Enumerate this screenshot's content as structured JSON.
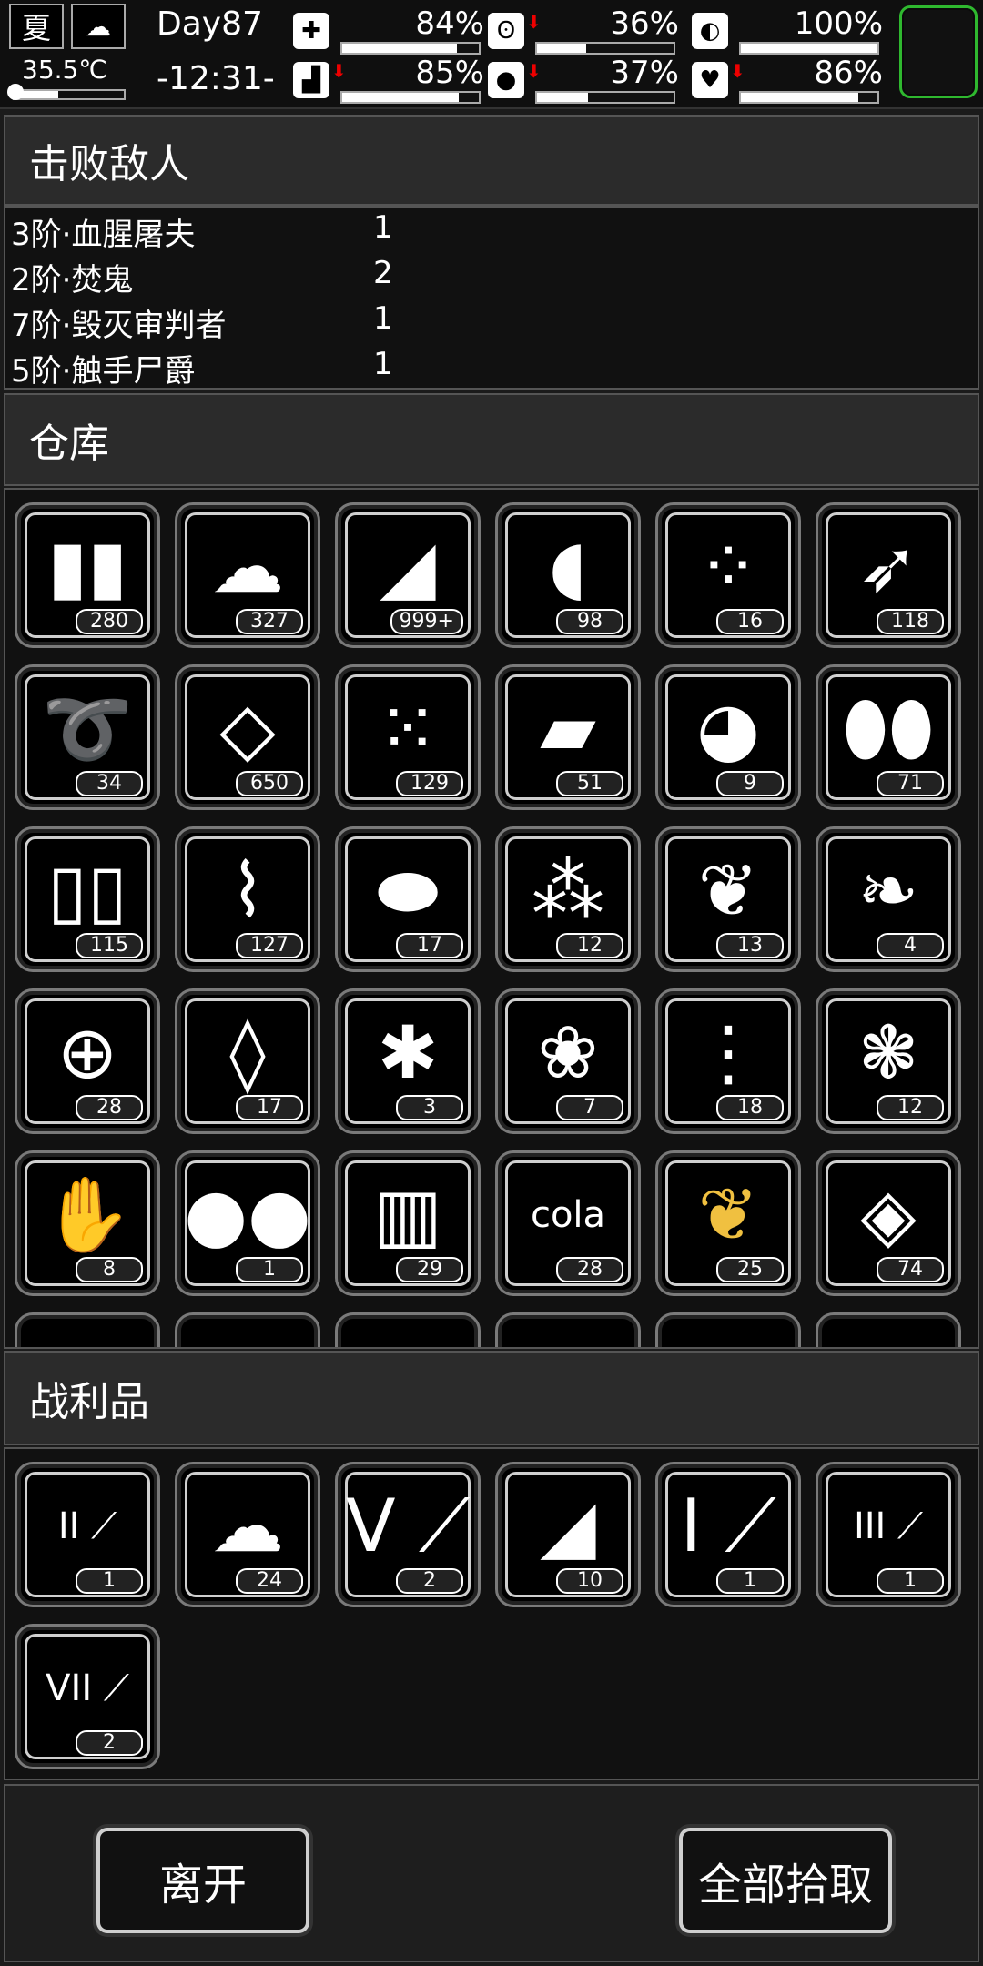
{
  "status": {
    "season": "夏",
    "weather_icon": "cloud-icon",
    "temperature": "35.5℃",
    "day": "Day87",
    "time": "-12:31-",
    "stats": [
      {
        "icon": "health-icon",
        "glyph": "✚",
        "percent": "84%",
        "value": 0.84,
        "arrow": false
      },
      {
        "icon": "stomach-icon",
        "glyph": "ʘ",
        "percent": "36%",
        "value": 0.36,
        "arrow": true
      },
      {
        "icon": "pill-icon",
        "glyph": "◐",
        "percent": "100%",
        "value": 1.0,
        "arrow": false
      },
      {
        "icon": "leg-icon",
        "glyph": "▟",
        "percent": "85%",
        "value": 0.85,
        "arrow": true
      },
      {
        "icon": "water-drop-icon",
        "glyph": "●",
        "percent": "37%",
        "value": 0.37,
        "arrow": true
      },
      {
        "icon": "heart-icon",
        "glyph": "♥",
        "percent": "86%",
        "value": 0.86,
        "arrow": true
      }
    ]
  },
  "sections": {
    "enemies_title": "击败敌人",
    "storage_title": "仓库",
    "loot_title": "战利品"
  },
  "enemies": [
    {
      "name": "3阶·血腥屠夫",
      "count": "1"
    },
    {
      "name": "2阶·焚鬼",
      "count": "2"
    },
    {
      "name": "7阶·毁灭审判者",
      "count": "1"
    },
    {
      "name": "5阶·触手尸爵",
      "count": "1"
    }
  ],
  "storage": [
    {
      "icon": "bullets-icon",
      "glyph": "▮▮",
      "qty": "280"
    },
    {
      "icon": "cloth-icon",
      "glyph": "☁",
      "qty": "327"
    },
    {
      "icon": "meat-wrap-icon",
      "glyph": "◢",
      "qty": "999+"
    },
    {
      "icon": "steak-icon",
      "glyph": "◖",
      "qty": "98"
    },
    {
      "icon": "seeds-icon",
      "glyph": "⁘",
      "qty": "16"
    },
    {
      "icon": "arrow-icon",
      "glyph": "➶",
      "qty": "118"
    },
    {
      "icon": "rope-icon",
      "glyph": "➰",
      "qty": "34"
    },
    {
      "icon": "scrap-metal-icon",
      "glyph": "◇",
      "qty": "650"
    },
    {
      "icon": "berries-icon",
      "glyph": "⁙",
      "qty": "129"
    },
    {
      "icon": "plastic-bottle-icon",
      "glyph": "▰",
      "qty": "51"
    },
    {
      "icon": "brain-icon",
      "glyph": "◕",
      "qty": "9"
    },
    {
      "icon": "shells-icon",
      "glyph": "⬮⬮",
      "qty": "71"
    },
    {
      "icon": "cartridges-icon",
      "glyph": "▯▯",
      "qty": "115"
    },
    {
      "icon": "rifle-rounds-icon",
      "glyph": "⌇",
      "qty": "127"
    },
    {
      "icon": "nuts-icon",
      "glyph": "⬬",
      "qty": "17"
    },
    {
      "icon": "grains-icon",
      "glyph": "⁂",
      "qty": "12"
    },
    {
      "icon": "mint-leaves-icon",
      "glyph": "❦",
      "qty": "13"
    },
    {
      "icon": "vine-icon",
      "glyph": "❧",
      "qty": "4"
    },
    {
      "icon": "batteries-icon",
      "glyph": "⊕",
      "qty": "28"
    },
    {
      "icon": "almonds-icon",
      "glyph": "◊",
      "qty": "17"
    },
    {
      "icon": "flower-icon",
      "glyph": "✱",
      "qty": "3"
    },
    {
      "icon": "herb-branch-icon",
      "glyph": "❀",
      "qty": "7"
    },
    {
      "icon": "small-seeds-icon",
      "glyph": "⋮",
      "qty": "18"
    },
    {
      "icon": "sprouts-icon",
      "glyph": "❃",
      "qty": "12"
    },
    {
      "icon": "ginger-icon",
      "glyph": "✋",
      "qty": "8"
    },
    {
      "icon": "hazelnuts-icon",
      "glyph": "●●",
      "qty": "1"
    },
    {
      "icon": "popcorn-icon",
      "glyph": "▥",
      "qty": "29"
    },
    {
      "icon": "cola-icon",
      "glyph": "cola",
      "qty": "28"
    },
    {
      "icon": "cocoa-pods-icon",
      "glyph": "❦",
      "qty": "25",
      "color": "#f0c040"
    },
    {
      "icon": "snack-tray-icon",
      "glyph": "◈",
      "qty": "74"
    }
  ],
  "loot": [
    {
      "icon": "potion-tube-II-icon",
      "glyph": "II ⟋",
      "qty": "1"
    },
    {
      "icon": "cloth-icon",
      "glyph": "☁",
      "qty": "24"
    },
    {
      "icon": "potion-tube-V-icon",
      "glyph": "V ⟋",
      "qty": "2"
    },
    {
      "icon": "meat-wrap-icon",
      "glyph": "◢",
      "qty": "10"
    },
    {
      "icon": "potion-tube-I-icon",
      "glyph": "I ⟋",
      "qty": "1"
    },
    {
      "icon": "potion-tube-III-icon",
      "glyph": "III ⟋",
      "qty": "1"
    },
    {
      "icon": "potion-tube-VII-icon",
      "glyph": "VII ⟋",
      "qty": "2"
    }
  ],
  "buttons": {
    "leave": "离开",
    "take_all": "全部拾取"
  }
}
